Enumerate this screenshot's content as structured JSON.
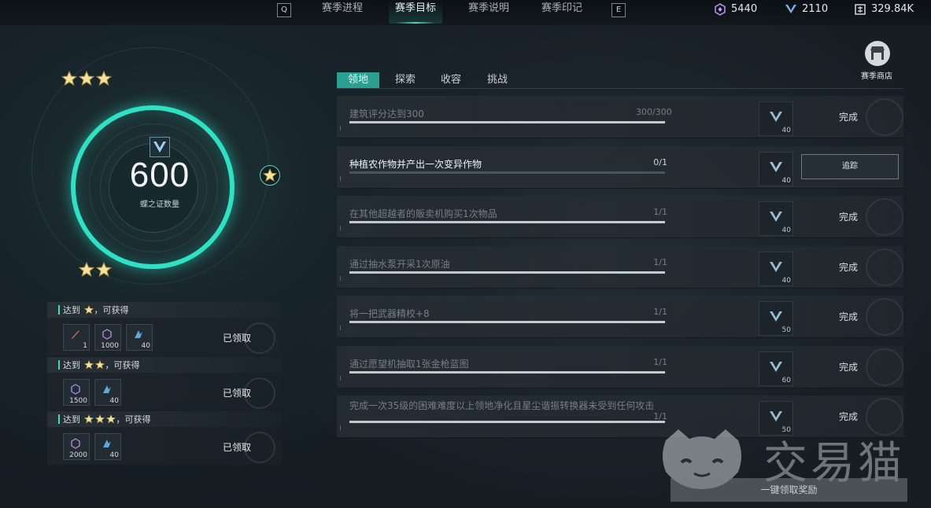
{
  "topbar": {
    "left_key": "Q",
    "right_key": "E",
    "tabs": [
      {
        "label": "赛季进程"
      },
      {
        "label": "赛季目标"
      },
      {
        "label": "赛季说明"
      },
      {
        "label": "赛季印记"
      }
    ],
    "active_tab": "赛季目标",
    "currencies": [
      {
        "icon": "crystal-icon",
        "value": "5440"
      },
      {
        "icon": "butterfly-icon",
        "value": "2110"
      },
      {
        "icon": "coin-icon",
        "value": "329.84K"
      }
    ]
  },
  "progress": {
    "count": "600",
    "label": "蝶之证数量",
    "accent": "#2fe0c4"
  },
  "rewards": [
    {
      "stars": 1,
      "prefix": "达到",
      "suffix": "，可获得",
      "items": [
        {
          "icon": "dagger-icon",
          "count": "1"
        },
        {
          "icon": "crystal-icon",
          "count": "1000"
        },
        {
          "icon": "shard-icon",
          "count": "40"
        }
      ],
      "status": "已领取"
    },
    {
      "stars": 2,
      "prefix": "达到",
      "suffix": "，可获得",
      "items": [
        {
          "icon": "crystal-icon",
          "count": "1500"
        },
        {
          "icon": "shard-icon",
          "count": "40"
        }
      ],
      "status": "已领取"
    },
    {
      "stars": 3,
      "prefix": "达到",
      "suffix": "，可获得",
      "items": [
        {
          "icon": "crystal-icon",
          "count": "2000"
        },
        {
          "icon": "shard-icon",
          "count": "40"
        }
      ],
      "status": "已领取"
    }
  ],
  "task_tabs": [
    {
      "label": "领地"
    },
    {
      "label": "探索"
    },
    {
      "label": "收容"
    },
    {
      "label": "挑战"
    }
  ],
  "tasks": [
    {
      "text": "建筑评分达到300",
      "progress": "300/300",
      "fill": 1.0,
      "reward": "40",
      "status": "完成",
      "state": "done"
    },
    {
      "text": "种植农作物并产出一次变异作物",
      "progress": "0/1",
      "fill": 0.0,
      "reward": "40",
      "status": "追踪",
      "state": "active"
    },
    {
      "text": "在其他超越者的贩卖机购买1次物品",
      "progress": "1/1",
      "fill": 1.0,
      "reward": "40",
      "status": "完成",
      "state": "done"
    },
    {
      "text": "通过抽水泵开采1次原油",
      "progress": "1/1",
      "fill": 1.0,
      "reward": "40",
      "status": "完成",
      "state": "done"
    },
    {
      "text": "将一把武器精校+8",
      "progress": "1/1",
      "fill": 1.0,
      "reward": "50",
      "status": "完成",
      "state": "done"
    },
    {
      "text": "通过愿望机抽取1张金枪蓝图",
      "progress": "1/1",
      "fill": 1.0,
      "reward": "60",
      "status": "完成",
      "state": "done"
    },
    {
      "text": "完成一次35级的困难难度以上领地净化且星尘谐振转换器未受到任何攻击",
      "progress": "1/1",
      "fill": 1.0,
      "reward": "50",
      "status": "完成",
      "state": "done"
    }
  ],
  "shop": {
    "label": "赛季商店"
  },
  "watermark": {
    "text": "交易猫"
  },
  "claim_all": {
    "label": "一键领取奖励"
  }
}
